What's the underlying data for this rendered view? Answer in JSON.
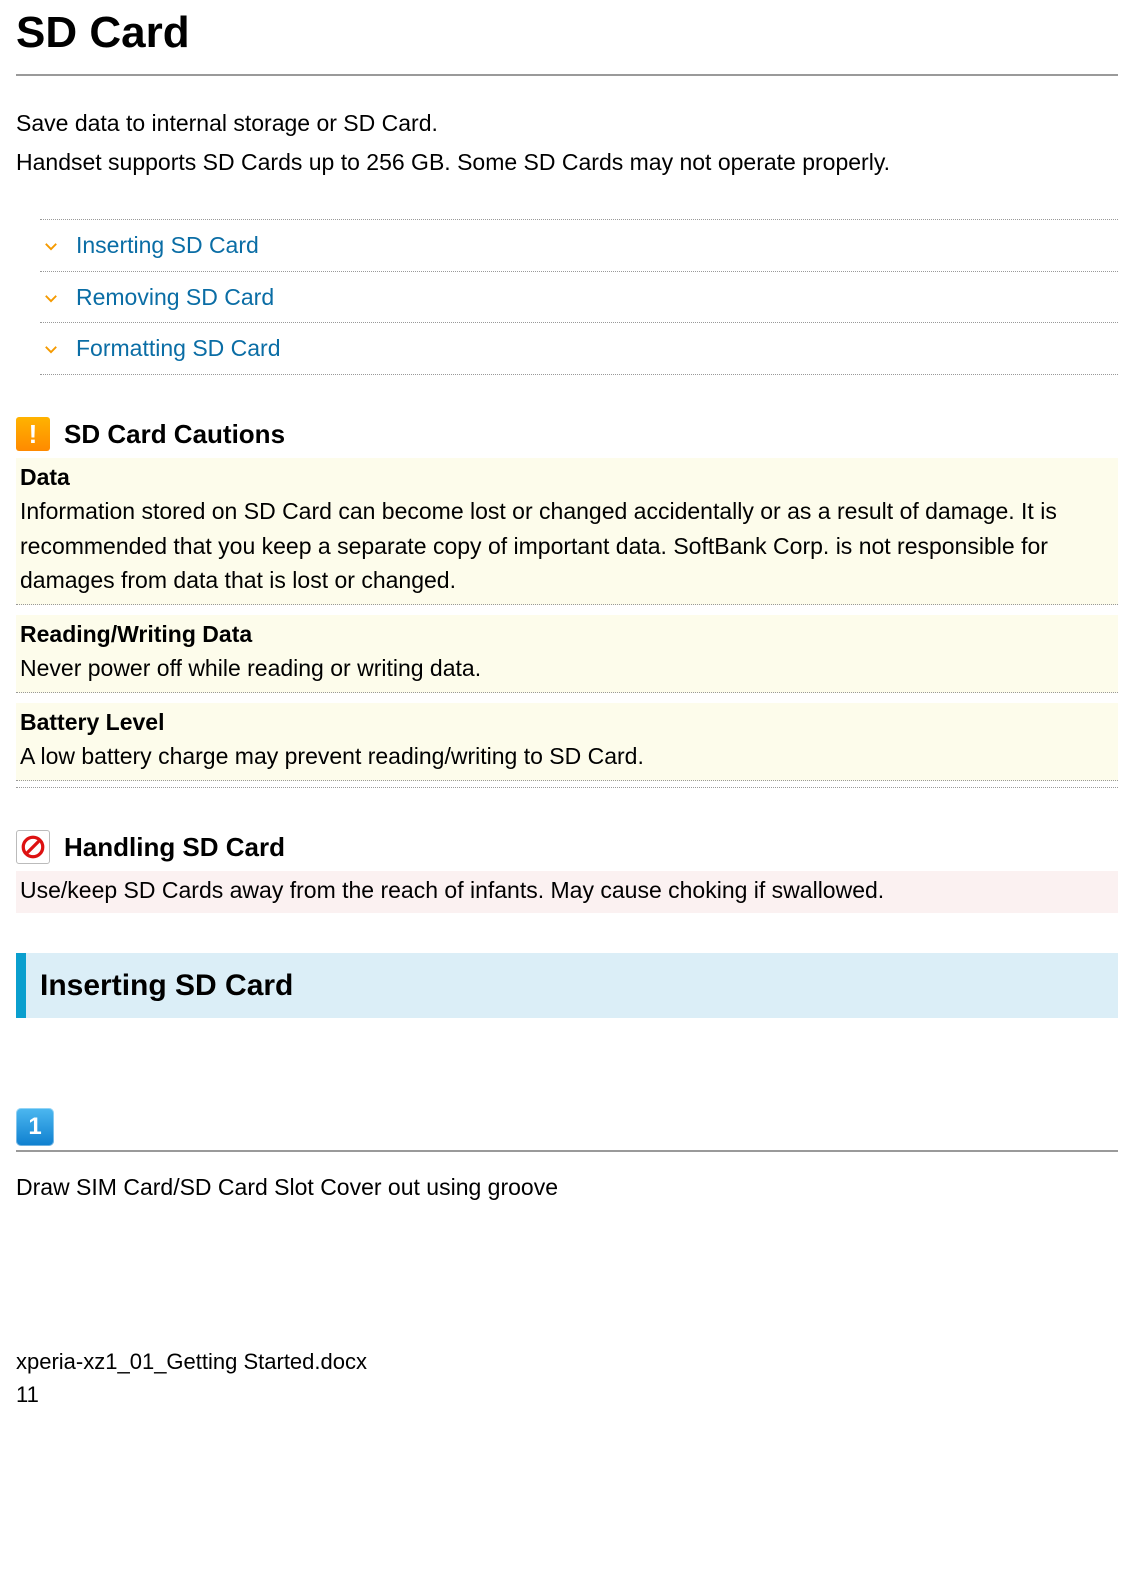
{
  "title": "SD Card",
  "intro": {
    "line1": "Save data to internal storage or SD Card.",
    "line2": "Handset supports SD Cards up to 256 GB. Some SD Cards may not operate properly."
  },
  "toc": {
    "items": [
      {
        "label": "Inserting SD Card"
      },
      {
        "label": "Removing SD Card"
      },
      {
        "label": "Formatting SD Card"
      }
    ]
  },
  "cautions": {
    "heading": "SD Card Cautions",
    "items": [
      {
        "label": "Data",
        "body": "Information stored on SD Card can become lost or changed accidentally or as a result of damage. It is recommended that you keep a separate copy of important data. SoftBank Corp. is not responsible for damages from data that is lost or changed."
      },
      {
        "label": "Reading/Writing Data",
        "body": "Never power off while reading or writing data."
      },
      {
        "label": "Battery Level",
        "body": "A low battery charge may prevent reading/writing to SD Card."
      }
    ]
  },
  "handling": {
    "heading": "Handling SD Card",
    "body": "Use/keep SD Cards away from the reach of infants. May cause choking if swallowed."
  },
  "section": {
    "heading": "Inserting SD Card"
  },
  "step1": {
    "number": "1",
    "text": "Draw SIM Card/SD Card Slot Cover out using groove"
  },
  "footer": {
    "file": "xperia-xz1_01_Getting Started.docx",
    "page": "11"
  }
}
